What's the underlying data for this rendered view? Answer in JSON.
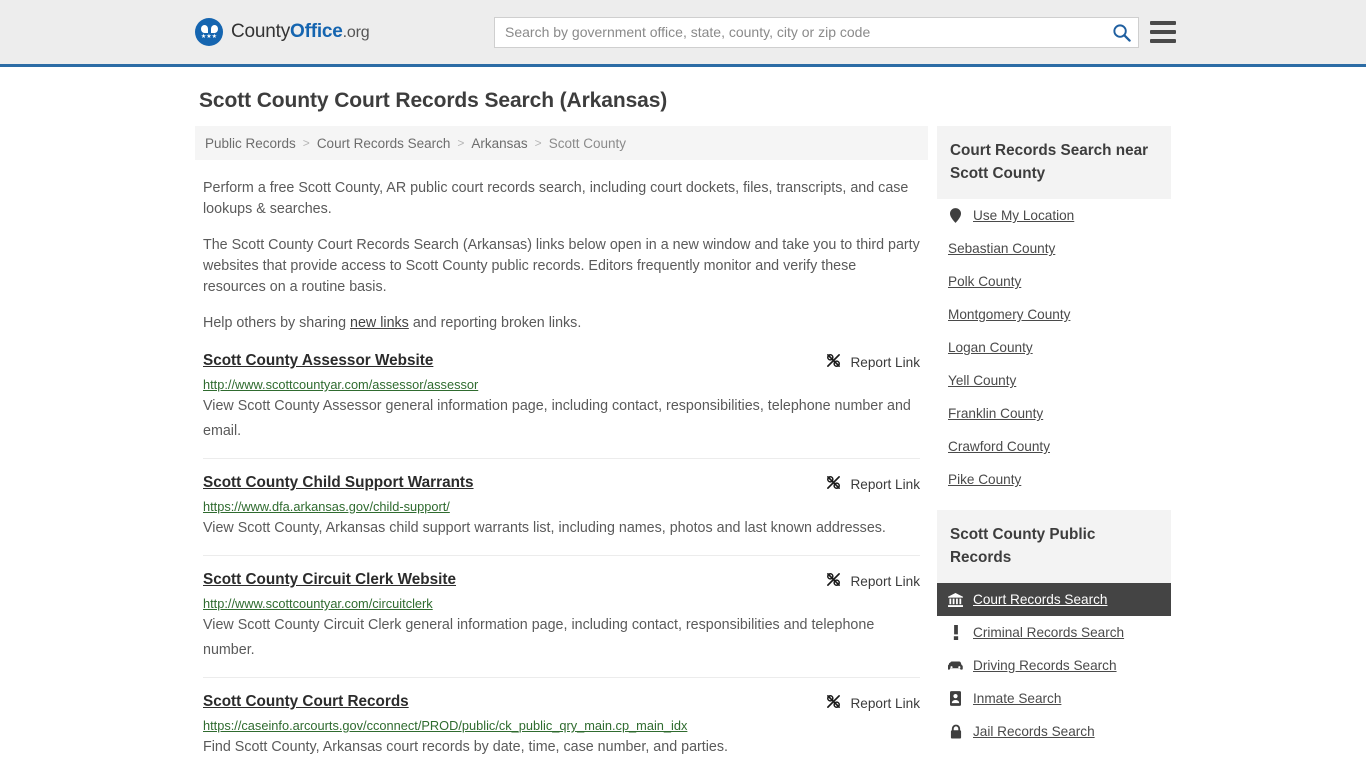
{
  "header": {
    "brand": {
      "part1": "County",
      "part2": "Office",
      "part3": ".org",
      "logo_icon": "eagle-logo-icon"
    },
    "search": {
      "placeholder": "Search by government office, state, county, city or zip code",
      "value": "",
      "search_icon": "search-icon"
    },
    "menu_icon": "hamburger-menu-icon"
  },
  "page": {
    "title": "Scott County Court Records Search (Arkansas)"
  },
  "breadcrumb": {
    "items": [
      {
        "label": "Public Records",
        "current": false
      },
      {
        "label": "Court Records Search",
        "current": false
      },
      {
        "label": "Arkansas",
        "current": false
      },
      {
        "label": "Scott County",
        "current": true
      }
    ],
    "separator": ">"
  },
  "intro": {
    "p1": "Perform a free Scott County, AR public court records search, including court dockets, files, transcripts, and case lookups & searches.",
    "p2": "The Scott County Court Records Search (Arkansas) links below open in a new window and take you to third party websites that provide access to Scott County public records. Editors frequently monitor and verify these resources on a routine basis.",
    "p3_before": "Help others by sharing ",
    "p3_link": "new links",
    "p3_after": " and reporting broken links."
  },
  "listings": {
    "report_label": "Report Link",
    "report_icon": "broken-link-icon",
    "items": [
      {
        "title": "Scott County Assessor Website",
        "url": "http://www.scottcountyar.com/assessor/assessor",
        "desc": "View Scott County Assessor general information page, including contact, responsibilities, telephone number and email."
      },
      {
        "title": "Scott County Child Support Warrants",
        "url": "https://www.dfa.arkansas.gov/child-support/",
        "desc": "View Scott County, Arkansas child support warrants list, including names, photos and last known addresses."
      },
      {
        "title": "Scott County Circuit Clerk Website",
        "url": "http://www.scottcountyar.com/circuitclerk",
        "desc": "View Scott County Circuit Clerk general information page, including contact, responsibilities and telephone number."
      },
      {
        "title": "Scott County Court Records",
        "url": "https://caseinfo.arcourts.gov/cconnect/PROD/public/ck_public_qry_main.cp_main_idx",
        "desc": "Find Scott County, Arkansas court records by date, time, case number, and parties."
      }
    ]
  },
  "sidebar": {
    "nearby": {
      "heading": "Court Records Search near Scott County",
      "items": [
        {
          "label": "Use My Location",
          "icon": "location-pin-icon",
          "active": false
        },
        {
          "label": "Sebastian County",
          "icon": "",
          "active": false
        },
        {
          "label": "Polk County",
          "icon": "",
          "active": false
        },
        {
          "label": "Montgomery County",
          "icon": "",
          "active": false
        },
        {
          "label": "Logan County",
          "icon": "",
          "active": false
        },
        {
          "label": "Yell County",
          "icon": "",
          "active": false
        },
        {
          "label": "Franklin County",
          "icon": "",
          "active": false
        },
        {
          "label": "Crawford County",
          "icon": "",
          "active": false
        },
        {
          "label": "Pike County",
          "icon": "",
          "active": false
        }
      ]
    },
    "public_records": {
      "heading": "Scott County Public Records",
      "items": [
        {
          "label": "Court Records Search",
          "icon": "courthouse-icon",
          "active": true
        },
        {
          "label": "Criminal Records Search",
          "icon": "exclamation-icon",
          "active": false
        },
        {
          "label": "Driving Records Search",
          "icon": "car-icon",
          "active": false
        },
        {
          "label": "Inmate Search",
          "icon": "id-card-icon",
          "active": false
        },
        {
          "label": "Jail Records Search",
          "icon": "lock-icon",
          "active": false
        }
      ]
    }
  },
  "colors": {
    "brand_blue": "#1565b0",
    "header_bg": "#ededed",
    "header_border": "#2c6ca5",
    "url_green": "#2f6b2f",
    "active_bg": "#444444",
    "panel_bg": "#f3f3f3"
  }
}
